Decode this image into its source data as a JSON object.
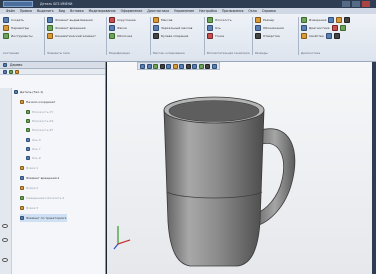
{
  "titlebar": {
    "app_tab": "Деталь БЕЗ ИМЕНИ"
  },
  "menu": [
    "Файл",
    "Правка",
    "Выделить",
    "Вид",
    "Вставка",
    "Моделирование",
    "Оформление",
    "Диагностика",
    "Управление",
    "Настройка",
    "Приложения",
    "Окно",
    "Справка"
  ],
  "ribbon": {
    "groups": [
      {
        "rows": [
          "Создать",
          "Параметры",
          "Инструменты"
        ],
        "label": "Системная"
      },
      {
        "rows": [
          "Элемент выдавливания",
          "Элемент вращения",
          "Кинематический элемент"
        ],
        "label": "Элементы тела"
      },
      {
        "rows": [
          "Скругление",
          "Фаска",
          "Оболочка"
        ],
        "label": "Модификация"
      },
      {
        "rows": [
          "Массив",
          "Зеркальный массив",
          "Булева операция"
        ],
        "label": "Массив, копирование"
      },
      {
        "rows": [
          "Плоскость",
          "Ось",
          "Точка"
        ],
        "label": "Вспомогательная геометрия"
      },
      {
        "rows": [
          "Размер",
          "Обозначения",
          "Отверстие"
        ],
        "label": "Размеры"
      },
      {
        "rows": [
          "Измерения",
          "Диагностика",
          "Свойства"
        ],
        "label": "Диагностика"
      }
    ]
  },
  "tree": {
    "title": "Дерево",
    "items": [
      {
        "label": "Деталь (Тел-1)",
        "state": "normal"
      },
      {
        "label": "Начало координат",
        "state": "normal"
      },
      {
        "label": "Плоскость XY",
        "state": "faded"
      },
      {
        "label": "Плоскость ZX",
        "state": "faded"
      },
      {
        "label": "Плоскость ZY",
        "state": "faded"
      },
      {
        "label": "Ось X",
        "state": "faded"
      },
      {
        "label": "Ось Y",
        "state": "faded"
      },
      {
        "label": "Ось Z",
        "state": "faded"
      },
      {
        "label": "Эскиз:1",
        "state": "faded"
      },
      {
        "label": "Элемент вращения:1",
        "state": "normal"
      },
      {
        "label": "Эскиз:2",
        "state": "faded"
      },
      {
        "label": "Смещенная плоскость:1",
        "state": "faded"
      },
      {
        "label": "Эскиз:3",
        "state": "faded"
      },
      {
        "label": "Элемент по траектории:1",
        "state": "normal"
      }
    ]
  },
  "colors": {
    "titlebar": "#2f3d52",
    "ribbon": "#e6ebf2",
    "viewport_bg": "#eff1f4",
    "mug_body": "#8e8e8e",
    "mug_shadow": "#5a5a5a"
  }
}
